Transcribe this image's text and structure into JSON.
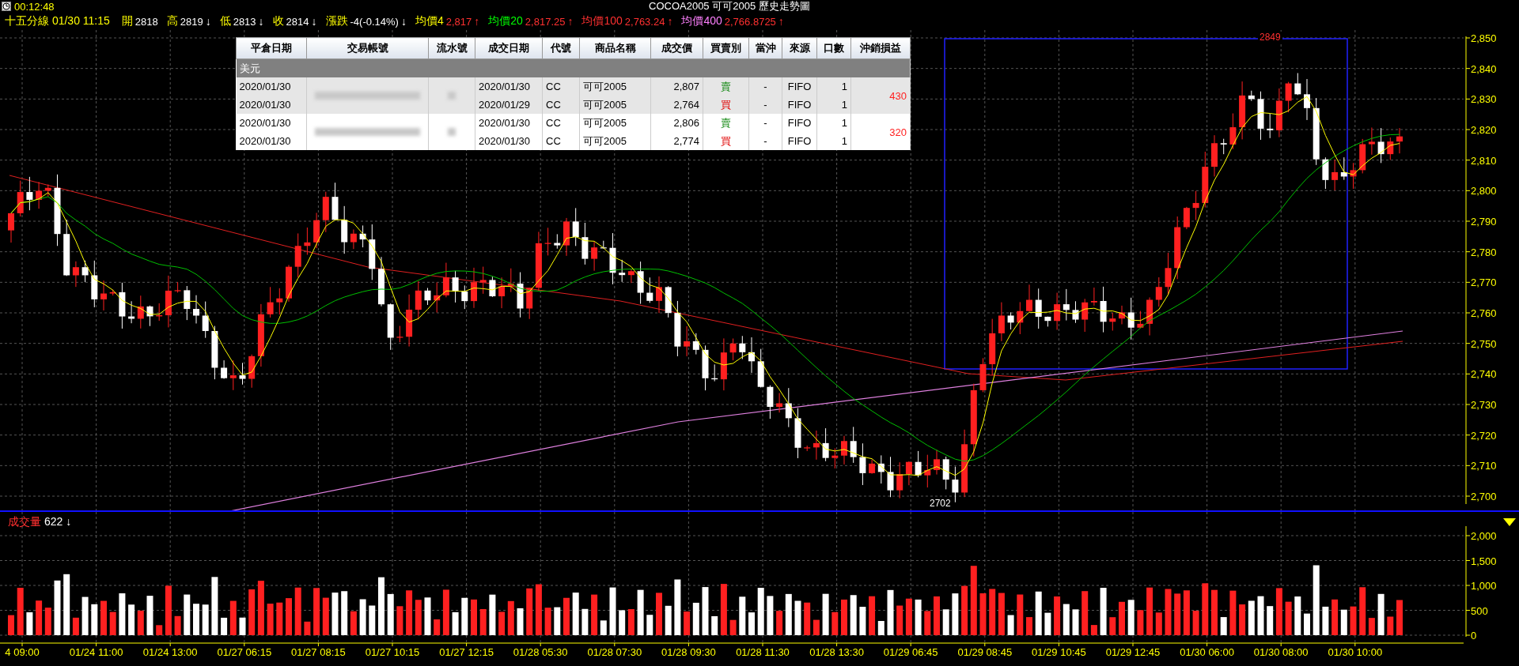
{
  "clock": "00:12:48",
  "title": "COCOA2005 可可2005 歷史走勢圖",
  "quote": {
    "period": "十五分線 01/30 11:15",
    "items": [
      {
        "label": "開",
        "value": "2818",
        "color": "#ffff00"
      },
      {
        "label": "高",
        "value": "2819",
        "arrow": "↓",
        "kind": "down",
        "color": "#ffff00"
      },
      {
        "label": "低",
        "value": "2813",
        "arrow": "↓",
        "kind": "down",
        "color": "#ffff00"
      },
      {
        "label": "收",
        "value": "2814",
        "arrow": "↓",
        "kind": "down",
        "color": "#ffff00"
      },
      {
        "label": "漲跌",
        "value": "-4(-0.14%)",
        "arrow": "↓",
        "kind": "down",
        "color": "#ffff00"
      },
      {
        "label": "均價4",
        "value": "2,817",
        "arrow": "↑",
        "kind": "up",
        "color": "#ffff00"
      },
      {
        "label": "均價20",
        "value": "2,817.25",
        "arrow": "↑",
        "kind": "up",
        "color": "#00ff00"
      },
      {
        "label": "均價100",
        "value": "2,763.24",
        "arrow": "↑",
        "kind": "up",
        "color": "#ff3030"
      },
      {
        "label": "均價400",
        "value": "2,766.8725",
        "arrow": "↑",
        "kind": "up",
        "color": "#ff80ff"
      }
    ]
  },
  "table": {
    "columns": [
      "平倉日期",
      "交易帳號",
      "流水號",
      "成交日期",
      "代號",
      "商品名稱",
      "成交價",
      "買賣別",
      "當沖",
      "來源",
      "口數",
      "沖銷損益"
    ],
    "currency": "美元",
    "groups": [
      {
        "selected": true,
        "profit": "430",
        "rows": [
          {
            "close_date": "2020/01/30",
            "trade_date": "2020/01/30",
            "code": "CC",
            "name": "可可2005",
            "price": "2,807",
            "side": "賣",
            "kind": "sell",
            "day_trade": "-",
            "source": "FIFO",
            "qty": "1"
          },
          {
            "close_date": "2020/01/30",
            "trade_date": "2020/01/29",
            "code": "CC",
            "name": "可可2005",
            "price": "2,764",
            "side": "買",
            "kind": "buy",
            "day_trade": "-",
            "source": "FIFO",
            "qty": "1"
          }
        ]
      },
      {
        "selected": false,
        "profit": "320",
        "rows": [
          {
            "close_date": "2020/01/30",
            "trade_date": "2020/01/30",
            "code": "CC",
            "name": "可可2005",
            "price": "2,806",
            "side": "賣",
            "kind": "sell",
            "day_trade": "-",
            "source": "FIFO",
            "qty": "1"
          },
          {
            "close_date": "2020/01/30",
            "trade_date": "2020/01/30",
            "code": "CC",
            "name": "可可2005",
            "price": "2,774",
            "side": "買",
            "kind": "buy",
            "day_trade": "-",
            "source": "FIFO",
            "qty": "1"
          }
        ]
      }
    ]
  },
  "chart": {
    "high_label": "2849",
    "low_label": "2702",
    "yticks": [
      "2,850",
      "2,840",
      "2,830",
      "2,820",
      "2,810",
      "2,800",
      "2,790",
      "2,780",
      "2,770",
      "2,760",
      "2,750",
      "2,740",
      "2,730",
      "2,720",
      "2,710",
      "2,700"
    ]
  },
  "volume": {
    "label": "成交量",
    "value": "622",
    "arrow": "↓",
    "yticks": [
      "2,000",
      "1,500",
      "1,000",
      "500",
      "0"
    ]
  },
  "xlabels": [
    "4 09:00",
    "01/24 11:00",
    "01/24 13:00",
    "01/27 06:15",
    "01/27 08:15",
    "01/27 10:15",
    "01/27 12:15",
    "01/28 05:30",
    "01/28 07:30",
    "01/28 09:30",
    "01/28 11:30",
    "01/28 13:30",
    "01/29 06:45",
    "01/29 08:45",
    "01/29 10:45",
    "01/29 12:45",
    "01/30 06:00",
    "01/30 08:00",
    "01/30 10:00"
  ]
}
